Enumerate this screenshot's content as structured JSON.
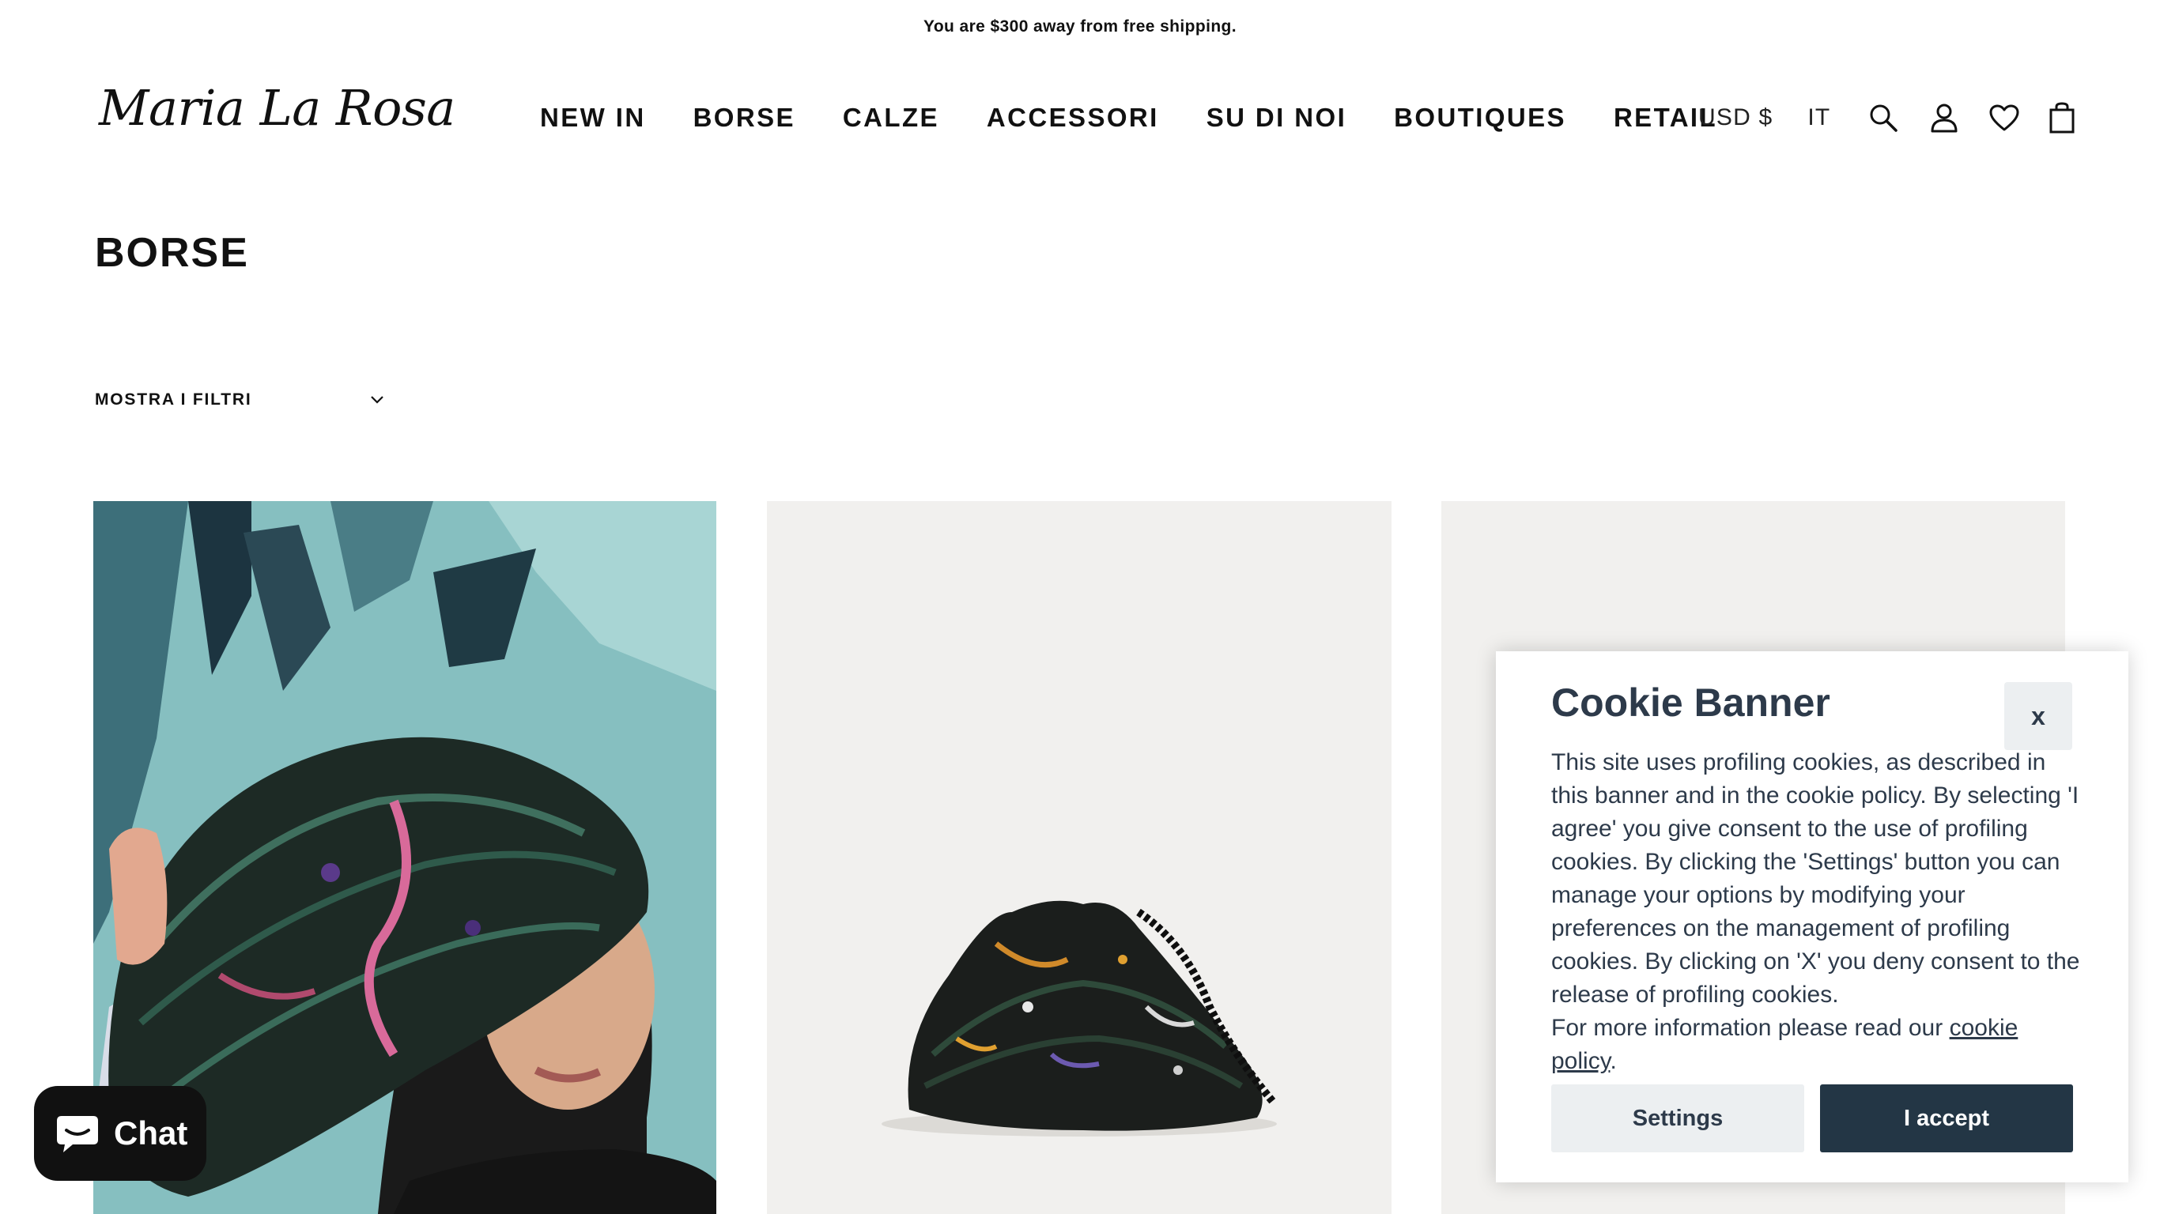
{
  "announcement": "You are $300 away from free shipping.",
  "logo": "Maria La Rosa",
  "nav": [
    {
      "label": "NEW IN"
    },
    {
      "label": "BORSE"
    },
    {
      "label": "CALZE"
    },
    {
      "label": "ACCESSORI"
    },
    {
      "label": "SU DI NOI"
    },
    {
      "label": "BOUTIQUES"
    },
    {
      "label": "RETAIL"
    }
  ],
  "utils": {
    "currency": "USD $",
    "language": "IT",
    "icons": [
      "search-icon",
      "account-icon",
      "wishlist-heart-icon",
      "cart-bag-icon"
    ]
  },
  "page": {
    "title": "BORSE",
    "filters_label": "MOSTRA I FILTRI"
  },
  "products": [
    {
      "image": "woman-holding-woven-bag-photo"
    },
    {
      "image": "black-woven-pouch-bag-photo"
    },
    {
      "image": "product-image-placeholder"
    }
  ],
  "cookie_banner": {
    "title": "Cookie Banner",
    "close_label": "x",
    "body": "This site uses profiling cookies, as described in this banner and in the cookie policy. By selecting 'I agree' you give consent to the use of profiling cookies. By clicking the 'Settings' button you can manage your options by modifying your preferences on the management of profiling cookies. By clicking on 'X' you deny consent to the release of profiling cookies.",
    "more_info": "For more information please read our ",
    "link_text": "cookie policy",
    "link_suffix": ".",
    "settings_label": "Settings",
    "accept_label": "I accept"
  },
  "chat": {
    "label": "Chat"
  },
  "colors": {
    "accent_dark": "#233645",
    "cookie_text": "#2d3a4a",
    "button_light": "#eceff1",
    "card_bg": "#f1f0ee"
  }
}
